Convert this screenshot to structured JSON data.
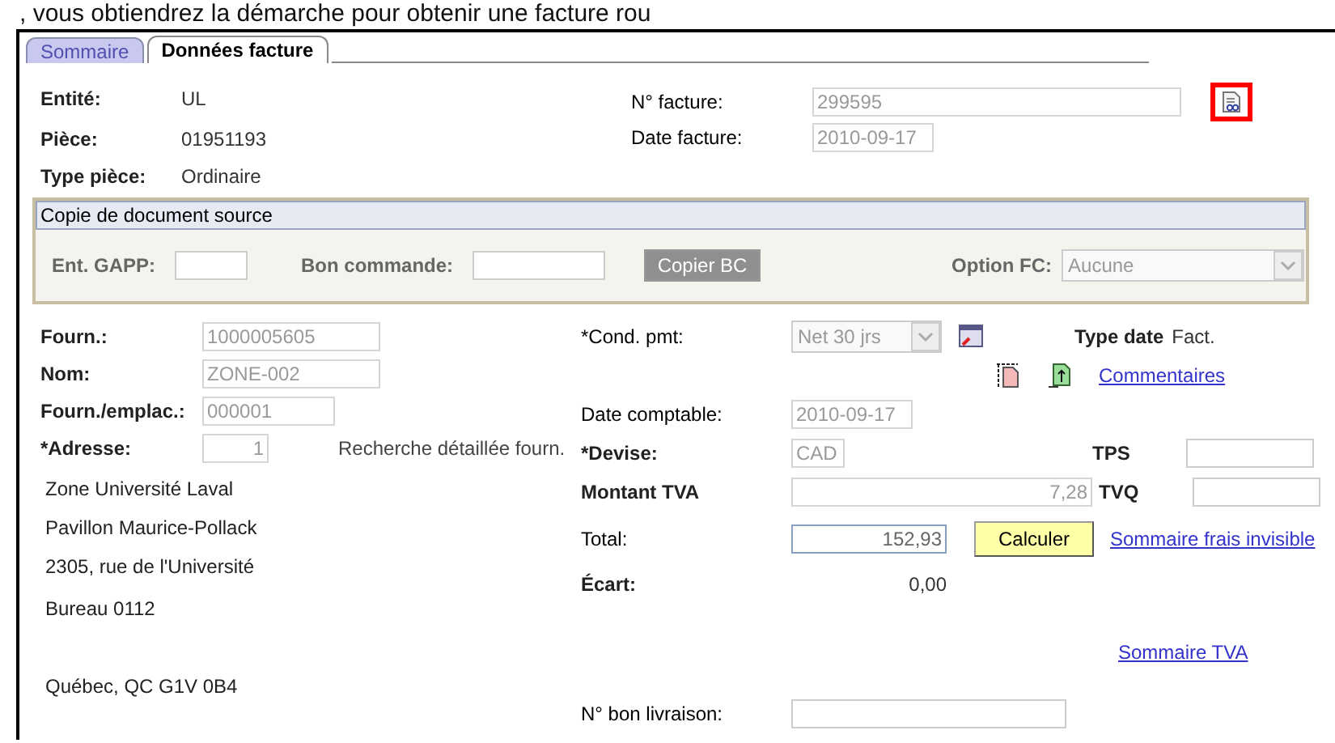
{
  "caption": ", vous obtiendrez la démarche pour obtenir une facture rou",
  "tabs": [
    {
      "label": "Sommaire",
      "selected": false
    },
    {
      "label": "Données facture",
      "selected": true
    }
  ],
  "header_left": [
    {
      "label": "Entité:",
      "value": "UL"
    },
    {
      "label": "Pièce:",
      "value": "01951193"
    },
    {
      "label": "Type pièce:",
      "value": "Ordinaire"
    }
  ],
  "header_right": [
    {
      "label": "N° facture:",
      "value": "299595",
      "disabled": true
    },
    {
      "label": "Date facture:",
      "value": "2010-09-17",
      "disabled": true
    }
  ],
  "invoice_icon": {
    "highlighted": true
  },
  "source_copy": {
    "title": "Copie de document source",
    "gapp_label": "Ent. GAPP:",
    "po_label": "Bon commande:",
    "copy_button": {
      "label": "Copier BC",
      "disabled": true
    },
    "option_label": "Option FC:",
    "option_value": "Aucune",
    "option_disabled": true
  },
  "supplier": [
    {
      "label": "Fourn.:",
      "value": "1000005605",
      "disabled": true
    },
    {
      "label": "Nom:",
      "value": "ZONE-002",
      "disabled": true
    },
    {
      "label": "Fourn./emplac.:",
      "value": "000001",
      "disabled": true
    },
    {
      "label": "*Adresse:",
      "value": "1",
      "disabled": true
    }
  ],
  "detailed_search": "Recherche détaillée fourn.",
  "address_lines": [
    "Zone Université Laval",
    "Pavillon Maurice-Pollack",
    "2305, rue de l'Université",
    "Bureau 0112",
    "Québec, QC  G1V 0B4"
  ],
  "payment_terms": {
    "label": "*Cond. pmt:",
    "value": "Net 30 jrs",
    "disabled": true
  },
  "date_type": {
    "label": "Type date",
    "value": "Fact."
  },
  "comments_link": "Commentaires",
  "accounting_date": {
    "label": "Date comptable:",
    "value": "2010-09-17",
    "disabled": true
  },
  "currency": {
    "label": "*Devise:",
    "value": "CAD",
    "disabled": true
  },
  "vat_amount": {
    "label": "Montant TVA",
    "value": "7,28",
    "disabled": true
  },
  "total": {
    "label": "Total:",
    "value": "152,93",
    "disabled": false
  },
  "calculate_button": "Calculer",
  "gap": {
    "label": "Écart:",
    "value": "0,00"
  },
  "tps": {
    "label": "TPS"
  },
  "tvq": {
    "label": "TVQ"
  },
  "hidden_fees_link": "Sommaire frais invisible",
  "vat_summary_link": "Sommaire TVA",
  "delivery_note": {
    "label": "N° bon livraison:"
  }
}
